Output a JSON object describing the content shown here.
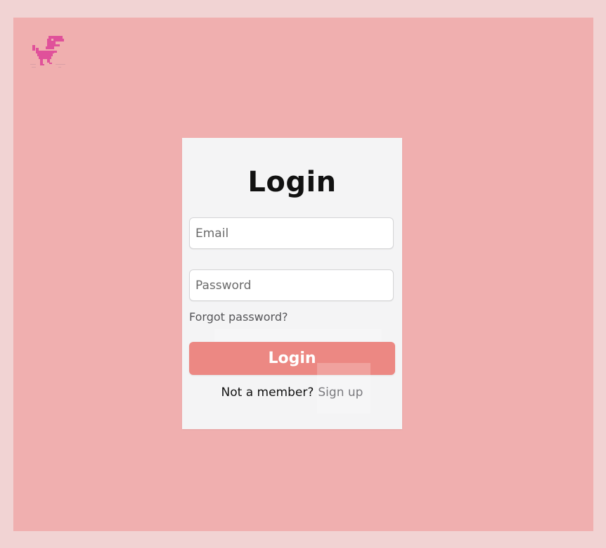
{
  "brand": {
    "logo_icon": "pixel-dinosaur-icon",
    "logo_color": "#e0519a"
  },
  "login_form": {
    "title": "Login",
    "email_placeholder": "Email",
    "password_placeholder": "Password",
    "forgot_password": "Forgot password?",
    "submit_label": "Login",
    "member_prompt": "Not a member?",
    "signup_label": "Sign up"
  },
  "colors": {
    "page_background": "#f1d3d3",
    "frame_background": "#f0afaf",
    "card_background": "#f4f4f5",
    "button_background": "#ec8883"
  }
}
